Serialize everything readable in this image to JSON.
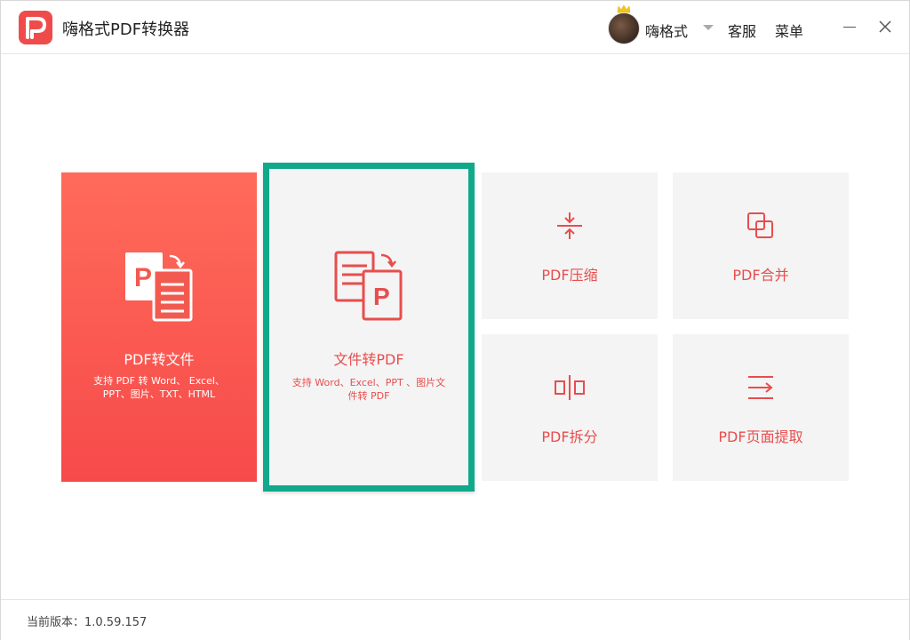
{
  "app": {
    "title": "嗨格式PDF转换器"
  },
  "header": {
    "username": "嗨格式",
    "service_label": "客服",
    "menu_label": "菜单"
  },
  "cards": {
    "pdf_to_file": {
      "title": "PDF转文件",
      "desc_line1": "支持 PDF 转 Word、 Excel、",
      "desc_line2": "PPT、图片、TXT、HTML"
    },
    "file_to_pdf": {
      "title": "文件转PDF",
      "desc_line1": "支持 Word、Excel、PPT 、图片文",
      "desc_line2": "件转 PDF"
    },
    "compress": {
      "title": "PDF压缩"
    },
    "merge": {
      "title": "PDF合并"
    },
    "split": {
      "title": "PDF拆分"
    },
    "extract": {
      "title": "PDF页面提取"
    }
  },
  "footer": {
    "version_text": "当前版本：1.0.59.157"
  },
  "colors": {
    "accent": "#e84d4d",
    "primary_card_top": "#ff6b5a",
    "primary_card_bottom": "#f64a4a",
    "highlight_border": "#10a98a"
  }
}
